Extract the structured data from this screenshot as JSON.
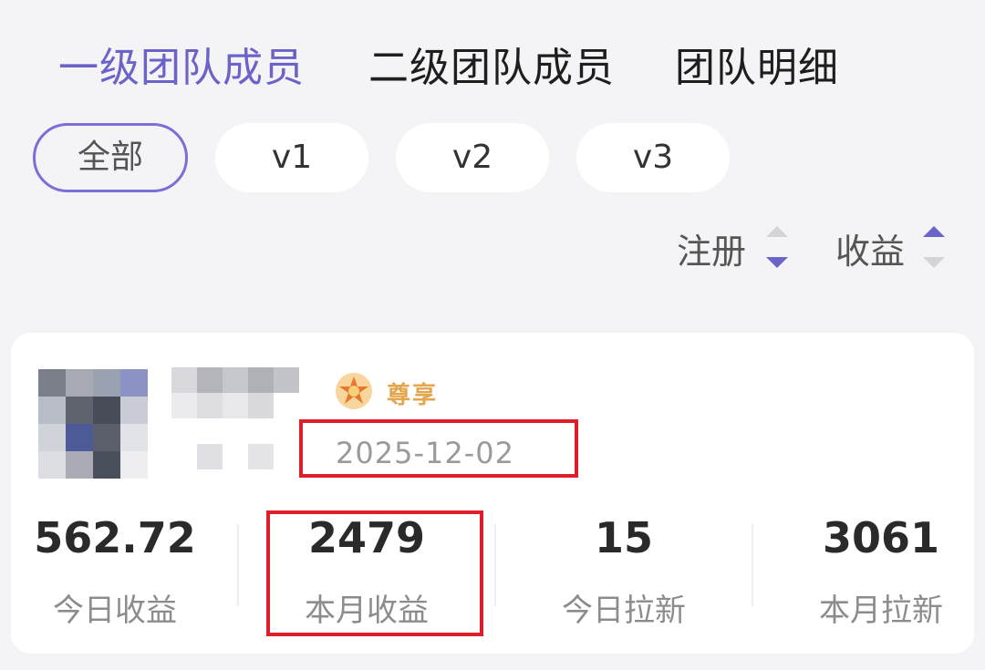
{
  "tabs": [
    {
      "label": "一级团队成员",
      "active": true
    },
    {
      "label": "二级团队成员",
      "active": false
    },
    {
      "label": "团队明细",
      "active": false
    }
  ],
  "filters": [
    {
      "label": "全部",
      "active": true
    },
    {
      "label": "v1",
      "active": false
    },
    {
      "label": "v2",
      "active": false
    },
    {
      "label": "v3",
      "active": false
    }
  ],
  "sort": {
    "register_label": "注册",
    "register_direction": "descending",
    "income_label": "收益",
    "income_direction": "ascending"
  },
  "member": {
    "badge_label": "尊享",
    "date": "2025-12-02",
    "stats": [
      {
        "value": "562.72",
        "label": "今日收益"
      },
      {
        "value": "2479",
        "label": "本月收益"
      },
      {
        "value": "15",
        "label": "今日拉新"
      },
      {
        "value": "3061",
        "label": "本月拉新"
      }
    ]
  },
  "colors": {
    "accent": "#6c63c9",
    "highlight_box": "#e01e2a",
    "badge": "#e4a64c"
  }
}
